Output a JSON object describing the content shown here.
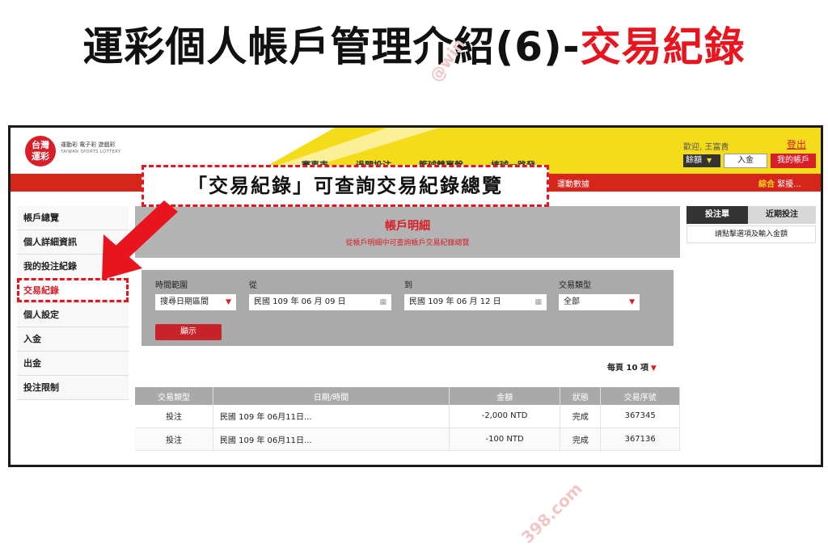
{
  "heading": {
    "main": "運彩個人帳戶管理介紹(6)-",
    "highlight": "交易紀錄"
  },
  "watermarks": {
    "top": "@win",
    "bottom": "398.com"
  },
  "header": {
    "logo_text": "台灣\n運彩",
    "logo_brand": "運動彩 電子彩 遊戲彩",
    "logo_en": "TAIWAN SPORTS LOTTERY",
    "nav": [
      "賽事表",
      "過關投注",
      "籃球雙贏盤",
      "棒球一路發"
    ],
    "welcome": "歡迎, 王富貴",
    "logout": "登出",
    "balance_select": "餘額",
    "deposit_button": "入金",
    "my_account_button": "我的帳戶",
    "redbar_left": "運動數據",
    "redbar_right_b": "綜合",
    "redbar_right": "緊擾..."
  },
  "sidebar": {
    "items": [
      {
        "label": "帳戶總覽"
      },
      {
        "label": "個人詳細資訊"
      },
      {
        "label": "我的投注紀錄"
      },
      {
        "label": "交易紀錄"
      },
      {
        "label": "個人設定"
      },
      {
        "label": "入金"
      },
      {
        "label": "出金"
      },
      {
        "label": "投注限制"
      }
    ]
  },
  "account_detail": {
    "title": "帳戶明細",
    "subtitle": "從帳戶明細中可查詢帳戶交易紀錄總覽"
  },
  "filter": {
    "time_range_label": "時間範圍",
    "time_range_value": "搜尋日期區間",
    "from_label": "從",
    "from_value": "民國 109 年 06 月 09 日",
    "to_label": "到",
    "to_value": "民國 109 年 06 月 12 日",
    "type_label": "交易類型",
    "type_value": "全部",
    "show_button": "顯示"
  },
  "per_page": "每頁 10 項",
  "table": {
    "headers": [
      "交易類型",
      "日期/時間",
      "金額",
      "狀態",
      "交易序號"
    ],
    "rows": [
      [
        "投注",
        "民國 109 年 06月11日...",
        "-2,000 NTD",
        "完成",
        "367345"
      ],
      [
        "投注",
        "民國 109 年 06月11日...",
        "-100 NTD",
        "完成",
        "367136"
      ]
    ]
  },
  "right_panel": {
    "tab_bet": "投注單",
    "tab_recent": "近期投注",
    "message": "請點擊選項及輸入金額"
  },
  "callout": "「交易紀錄」可查詢交易紀錄總覽",
  "colors": {
    "brand_red": "#e8141e",
    "header_yellow": "#f5dc1a"
  }
}
